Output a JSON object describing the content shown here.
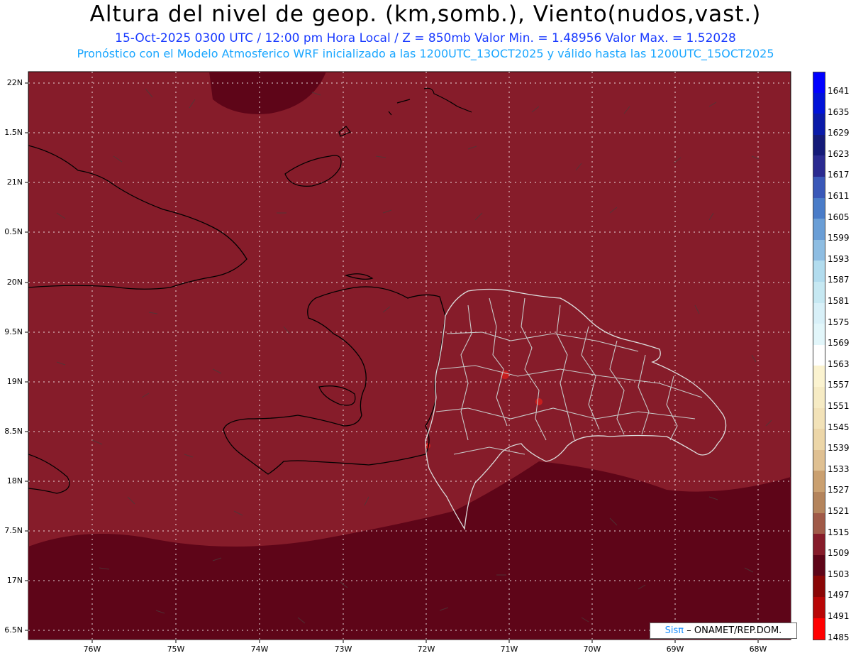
{
  "header": {
    "title": "Altura del nivel de geop. (km,somb.), Viento(nudos,vast.)",
    "subtitle_line1": "15-Oct-2025  0300 UTC / 12:00 pm Hora Local / Z = 850mb   Valor Min. = 1.48956  Valor Max. = 1.52028",
    "subtitle_line2": "Pronóstico con el Modelo Atmosferico WRF inicializado a las 1200UTC_13OCT2025 y válido hasta las  1200UTC_15OCT2025"
  },
  "axes": {
    "lat_labels": [
      "22N",
      "1.5N",
      "21N",
      "0.5N",
      "20N",
      "9.5N",
      "19N",
      "8.5N",
      "18N",
      "7.5N",
      "17N",
      "6.5N"
    ],
    "lon_labels": [
      "76W",
      "75W",
      "74W",
      "73W",
      "72W",
      "71W",
      "70W",
      "69W",
      "68W"
    ]
  },
  "colorbar": {
    "levels": [
      "1641",
      "1635",
      "1629",
      "1623",
      "1617",
      "1611",
      "1605",
      "1599",
      "1593",
      "1587",
      "1581",
      "1575",
      "1569",
      "1563",
      "1557",
      "1551",
      "1545",
      "1539",
      "1533",
      "1527",
      "1521",
      "1515",
      "1509",
      "1503",
      "1497",
      "1491",
      "1485"
    ],
    "colors": [
      "#0000ff",
      "#0012d8",
      "#0a1aa8",
      "#141a78",
      "#2a2a90",
      "#3a58b8",
      "#4a7cc8",
      "#6a9ed6",
      "#8ebde2",
      "#b2dcee",
      "#c6e8f2",
      "#d8f0f8",
      "#e2f6fa",
      "#ffffff",
      "#fbf3d0",
      "#f6ebc4",
      "#f2e2b8",
      "#ecd6a8",
      "#dfc092",
      "#caa070",
      "#b4845c",
      "#a05a48",
      "#861c2a",
      "#5e0518",
      "#8a0606",
      "#b80606",
      "#ff0000"
    ],
    "field_main_color": "#861c2a",
    "field_low_color": "#5e0518"
  },
  "credit": {
    "logo": "Sisπ",
    "text": "– ONAMET/REP.DOM."
  }
}
